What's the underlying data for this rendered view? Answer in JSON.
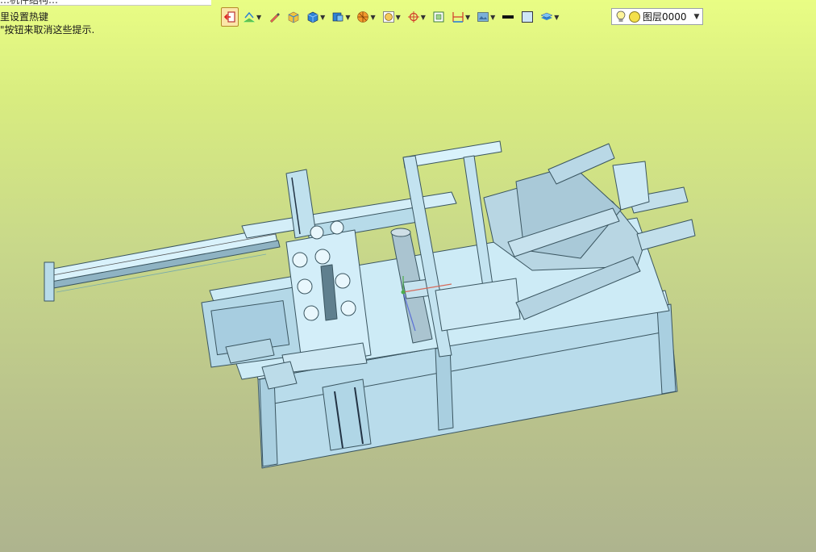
{
  "window": {
    "tab_title_fragment": "…机件结构…",
    "hint_line1": "里设置热键",
    "hint_line2": "\"按钮来取消这些提示."
  },
  "toolbar": {
    "buttons": [
      {
        "name": "exit-sketch",
        "icon": "exit-arrow-icon",
        "active": true,
        "dropdown": false
      },
      {
        "name": "sketch-tools",
        "icon": "sketch-tools-icon",
        "dropdown": true
      },
      {
        "name": "pencil",
        "icon": "pencil-icon",
        "dropdown": false
      },
      {
        "name": "box-solid",
        "icon": "box-solid-icon",
        "dropdown": false
      },
      {
        "name": "solid-view",
        "icon": "cube-icon",
        "dropdown": true
      },
      {
        "name": "shaded-view",
        "icon": "shaded-view-icon",
        "dropdown": true
      },
      {
        "name": "section",
        "icon": "section-icon",
        "dropdown": true
      },
      {
        "name": "zoom",
        "icon": "zoom-icon",
        "dropdown": true
      },
      {
        "name": "snap",
        "icon": "crosshair-icon",
        "dropdown": true
      },
      {
        "name": "frame",
        "icon": "frame-icon",
        "dropdown": false
      },
      {
        "name": "dimension",
        "icon": "dimension-icon",
        "dropdown": true
      },
      {
        "name": "render-mode",
        "icon": "render-mode-icon",
        "dropdown": true
      },
      {
        "name": "line-color",
        "icon": "line-color-icon",
        "dropdown": false
      },
      {
        "name": "fill-color",
        "icon": "fill-color-icon",
        "dropdown": false
      },
      {
        "name": "layers",
        "icon": "layers-icon",
        "dropdown": true
      }
    ],
    "layer_value": "图层0000"
  },
  "colors": {
    "model_fill": "#c5e7f3",
    "model_stroke": "#3a5560",
    "accent_active": "#fbe6a8"
  }
}
